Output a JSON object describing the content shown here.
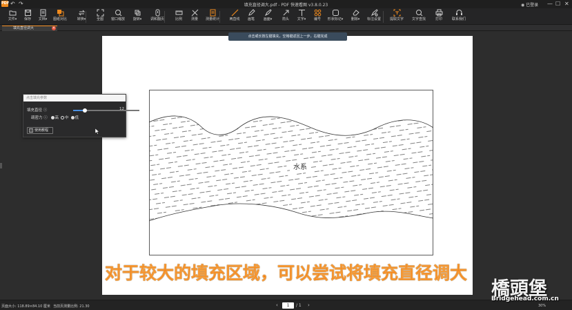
{
  "titlebar": {
    "logo_text": "PDF",
    "title": "填充直径调大.pdf - PDF 快速看图 v3.8.0.23",
    "login_label": "已登录",
    "min_glyph": "—",
    "max_glyph": "☐",
    "close_glyph": "✕",
    "undo_glyph": "↶",
    "redo_glyph": "↷"
  },
  "toolbar": {
    "items": [
      {
        "label": "文件▾",
        "icon": "folder-icon"
      },
      {
        "label": "保存",
        "icon": "save-icon"
      },
      {
        "label": "文档▾",
        "icon": "document-icon"
      },
      {
        "label": "图纸对比",
        "icon": "compare-icon"
      },
      {
        "label": "转换▾",
        "icon": "convert-icon"
      },
      {
        "label": "全图",
        "icon": "fullview-icon"
      },
      {
        "label": "窗口缩放",
        "icon": "zoom-window-icon"
      },
      {
        "label": "旋转▾",
        "icon": "rotate-icon"
      },
      {
        "label": "调和翻页",
        "icon": "page-turn-icon"
      },
      {
        "label": "比例",
        "icon": "scale-icon"
      },
      {
        "label": "测量",
        "icon": "measure-icon"
      },
      {
        "label": "测量统计",
        "icon": "measure-stats-icon"
      },
      {
        "label": "两直线",
        "icon": "line-icon"
      },
      {
        "label": "画笔",
        "icon": "pen-icon"
      },
      {
        "label": "画面▾",
        "icon": "brush-icon"
      },
      {
        "label": "箭头",
        "icon": "arrow-icon"
      },
      {
        "label": "文字▾",
        "icon": "text-icon"
      },
      {
        "label": "编号",
        "icon": "number-icon"
      },
      {
        "label": "形状标记▾",
        "icon": "shape-icon"
      },
      {
        "label": "删除▾",
        "icon": "eraser-icon"
      },
      {
        "label": "标注设置",
        "icon": "annotate-settings-icon"
      },
      {
        "label": "提取文字",
        "icon": "extract-text-icon"
      },
      {
        "label": "文字查找",
        "icon": "search-icon"
      },
      {
        "label": "打印",
        "icon": "print-icon"
      },
      {
        "label": "联系我们",
        "icon": "headset-icon"
      }
    ]
  },
  "tab": {
    "label": "填充直径调大",
    "close_glyph": "✕"
  },
  "hint": "点击或长按左键填充，空格键返回上一步，右键完成",
  "panel": {
    "header": "点击填充参数",
    "diameter_label": "填充直径",
    "diameter_value": "12",
    "diameter_fraction": 0.18,
    "density_label": "疏密力",
    "density_options": [
      {
        "label": "高",
        "selected": false
      },
      {
        "label": "中",
        "selected": true
      },
      {
        "label": "低",
        "selected": false
      }
    ],
    "help_glyph": "ⓘ",
    "tutorial_label": "使用教程"
  },
  "drawing": {
    "center_label": "水系"
  },
  "status": {
    "page_size": "页面大小: 118.89×84.10 厘米",
    "scale": "当前页测量比例: 21.30",
    "prev_glyph": "‹",
    "page_current": "1",
    "page_total": "/ 1",
    "next_glyph": "›",
    "zoom": "30%"
  },
  "caption": "对于较大的填充区域，可以尝试将填充直径调大",
  "watermark": {
    "brand": "橋頭堡",
    "url": "Bridgehead.com.cn"
  },
  "colors": {
    "accent": "#f08a1d",
    "caption": "#f07a10",
    "slider": "#4a90e2"
  }
}
